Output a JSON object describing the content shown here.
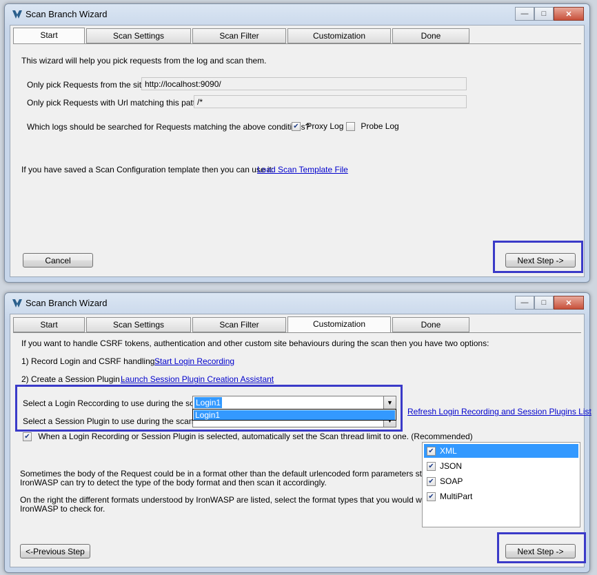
{
  "window1": {
    "title": "Scan Branch Wizard",
    "tabs": [
      "Start",
      "Scan Settings",
      "Scan Filter",
      "Customization",
      "Done"
    ],
    "selected_tab": "Start",
    "intro": "This wizard will help you pick requests from the log and scan them.",
    "site_label": "Only pick Requests from the site:",
    "site_value": "http://localhost:9090/",
    "url_label": "Only pick Requests with Url matching this pattern:",
    "url_value": "/*",
    "logs_label": "Which logs should be searched for Requests matching the above conditions?",
    "proxy_log": {
      "label": "Proxy Log",
      "checked": true
    },
    "probe_log": {
      "label": "Probe Log",
      "checked": false
    },
    "template_text": "If you have saved a Scan Configuration template then you can use it:",
    "template_link": "Load Scan Template File",
    "cancel": "Cancel",
    "next": "Next Step ->"
  },
  "window2": {
    "title": "Scan Branch Wizard",
    "tabs": [
      "Start",
      "Scan Settings",
      "Scan Filter",
      "Customization",
      "Done"
    ],
    "selected_tab": "Customization",
    "intro": "If you want to handle CSRF tokens, authentication and other custom site behaviours during the scan then you have two options:",
    "option1": "1) Record Login and CSRF handling -",
    "option1_link": "Start Login Recording",
    "option2": "2) Create a Session Plugin -",
    "option2_link": "Launch Session Plugin Creation Assistant",
    "login_label": "Select a Login Reccording to use during the scan:",
    "login_value": "Login1",
    "login_option": "Login1",
    "session_label": "Select a Session Plugin to use during the scan:",
    "refresh_link": "Refresh Login Recording and Session Plugins List",
    "thread_limit": {
      "label": "When a Login Recording or Session Plugin is selected, automatically set the Scan thread limit to one. (Recommended)",
      "checked": true
    },
    "body_text1": "Sometimes the body of the Request could be in a format other than the default urlencoded form parameters structure.",
    "body_text2": "IronWASP can try to detect the type of the body format and then scan it accordingly.",
    "formats_text1": "On the right the different formats understood by IronWASP are listed, select the format types that you would want",
    "formats_text2": "IronWASP to check for.",
    "formats": [
      {
        "label": "XML",
        "checked": true,
        "selected": true
      },
      {
        "label": "JSON",
        "checked": true,
        "selected": false
      },
      {
        "label": "SOAP",
        "checked": true,
        "selected": false
      },
      {
        "label": "MultiPart",
        "checked": true,
        "selected": false
      }
    ],
    "prev": "<-Previous Step",
    "next": "Next Step ->"
  },
  "colors": {
    "highlight": "#3a3ac8",
    "link": "#0000cc",
    "selection": "#3399ff"
  }
}
